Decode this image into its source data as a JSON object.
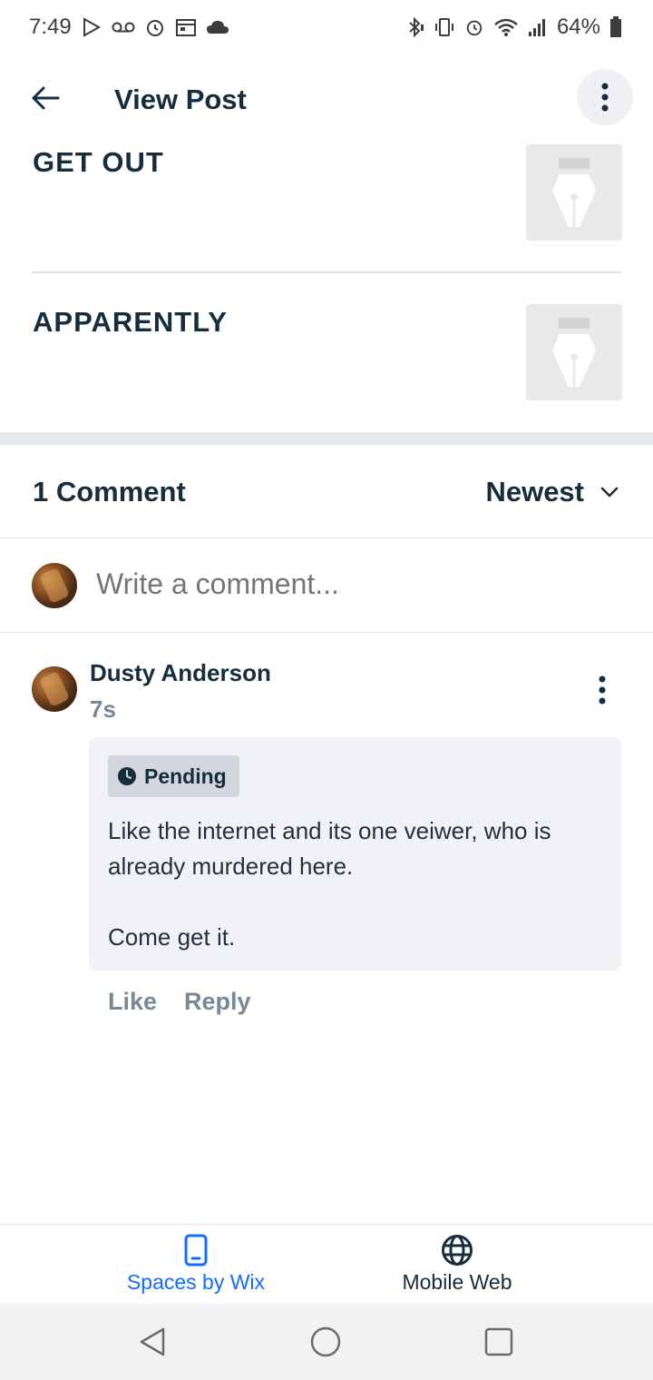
{
  "status_bar": {
    "time": "7:49",
    "battery": "64%",
    "left_icons": [
      "play-store-icon",
      "voicemail-icon",
      "alarm-icon",
      "calendar-icon",
      "cloud-icon"
    ],
    "right_icons": [
      "bluetooth-icon",
      "vibrate-icon",
      "alarm-icon",
      "wifi-icon",
      "signal-icon",
      "battery-icon"
    ]
  },
  "header": {
    "title": "View Post"
  },
  "posts": [
    {
      "title": "GET OUT"
    },
    {
      "title": "APPARENTLY"
    }
  ],
  "comments_section": {
    "count_label": "1 Comment",
    "sort_label": "Newest",
    "write_placeholder": "Write a comment..."
  },
  "comment": {
    "author": "Dusty Anderson",
    "time": "7s",
    "status": "Pending",
    "paragraph_1": "Like the internet and its one veiwer, who is already murdered here.",
    "paragraph_2": "Come get it.",
    "like_label": "Like",
    "reply_label": "Reply"
  },
  "bottom_tabs": {
    "spaces_label": "Spaces by Wix",
    "mobile_label": "Mobile Web"
  },
  "colors": {
    "primary_text": "#162d3d",
    "accent": "#116dff",
    "muted": "#7a8794",
    "bubble_bg": "#f0f2f5"
  }
}
